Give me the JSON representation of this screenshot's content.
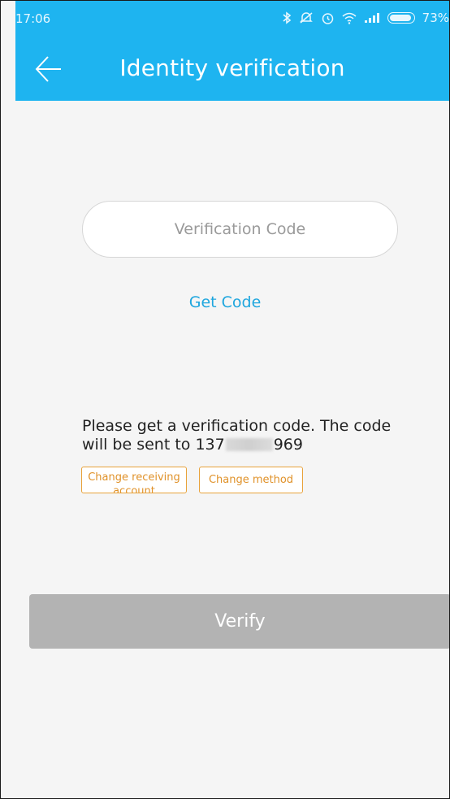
{
  "status_bar": {
    "time": "17:06",
    "icons": [
      "bluetooth-icon",
      "mute-icon",
      "alarm-icon",
      "wifi-icon",
      "signal-icon",
      "battery-icon"
    ],
    "battery_percent": "73%"
  },
  "header": {
    "back_icon": "arrow-left-icon",
    "title": "Identity verification",
    "background": "#1eb4f0"
  },
  "form": {
    "code_placeholder": "Verification Code",
    "code_value": "",
    "get_code_label": "Get Code"
  },
  "info": {
    "line1": "Please get a verification code. The code",
    "line2_prefix": "will be sent to 137",
    "line2_suffix": "969",
    "change_account_label": "Change receiving account",
    "change_method_label": "Change method"
  },
  "verify_label": "Verify",
  "colors": {
    "accent": "#1eb4f0",
    "link": "#1ea6de",
    "outline_orange": "#e8a23a",
    "verify_disabled": "#b3b3b3"
  }
}
